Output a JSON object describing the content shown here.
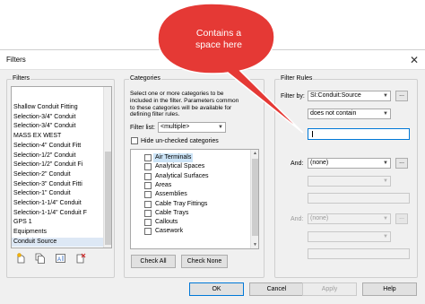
{
  "window": {
    "title": "Filters",
    "close_icon": "close-icon"
  },
  "callout": {
    "text_line1": "Contains a",
    "text_line2": "space here",
    "color": "#e53935"
  },
  "filters_panel": {
    "legend": "Filters",
    "items": [
      {
        "label": "Shallow Conduit Fitting"
      },
      {
        "label": "Selection-3/4\" Conduit"
      },
      {
        "label": "Selection-3/4\" Conduit"
      },
      {
        "label": "MASS EX WEST"
      },
      {
        "label": "Selection-4\" Conduit Fitt"
      },
      {
        "label": "Selection-1/2\" Conduit"
      },
      {
        "label": "Selection-1/2\" Conduit Fi"
      },
      {
        "label": "Selection-2\" Conduit"
      },
      {
        "label": "Selection-3\" Conduit Fitti"
      },
      {
        "label": "Selection-1\" Conduit"
      },
      {
        "label": "Selection-1-1/4\" Conduit"
      },
      {
        "label": "Selection-1-1/4\" Conduit F"
      },
      {
        "label": "GPS 1"
      },
      {
        "label": "Equipments"
      },
      {
        "label": "Conduit Source",
        "selected": true
      }
    ],
    "tool_icons": [
      "new-filter-icon",
      "duplicate-filter-icon",
      "rename-filter-icon",
      "delete-filter-icon"
    ]
  },
  "categories_panel": {
    "legend": "Categories",
    "description": "Select one or more categories to be included in the filter.  Parameters common to these categories will be available for defining filter rules.",
    "filter_list_label": "Filter list:",
    "filter_list_value": "<multiple>",
    "hide_unchecked_label": "Hide un-checked categories",
    "items": [
      {
        "label": "Air Terminals",
        "checked": false,
        "selected": true
      },
      {
        "label": "Analytical Spaces",
        "checked": false
      },
      {
        "label": "Analytical Surfaces",
        "checked": false
      },
      {
        "label": "Areas",
        "checked": false
      },
      {
        "label": "Assemblies",
        "checked": false
      },
      {
        "label": "Cable Tray Fittings",
        "checked": false
      },
      {
        "label": "Cable Trays",
        "checked": false
      },
      {
        "label": "Callouts",
        "checked": false
      },
      {
        "label": "Casework",
        "checked": false
      }
    ],
    "check_all_label": "Check All",
    "check_none_label": "Check None"
  },
  "rules_panel": {
    "legend": "Filter Rules",
    "filter_by_label": "Filter by:",
    "filter_by_value": "SI:Conduit:Source",
    "operator_value": "does not contain",
    "value_text": "",
    "and1_label": "And:",
    "and1_value": "(none)",
    "and2_label": "And:",
    "and2_value": "(none)",
    "ellipsis_label": "..."
  },
  "buttons": {
    "ok": "OK",
    "cancel": "Cancel",
    "apply": "Apply",
    "help": "Help"
  }
}
